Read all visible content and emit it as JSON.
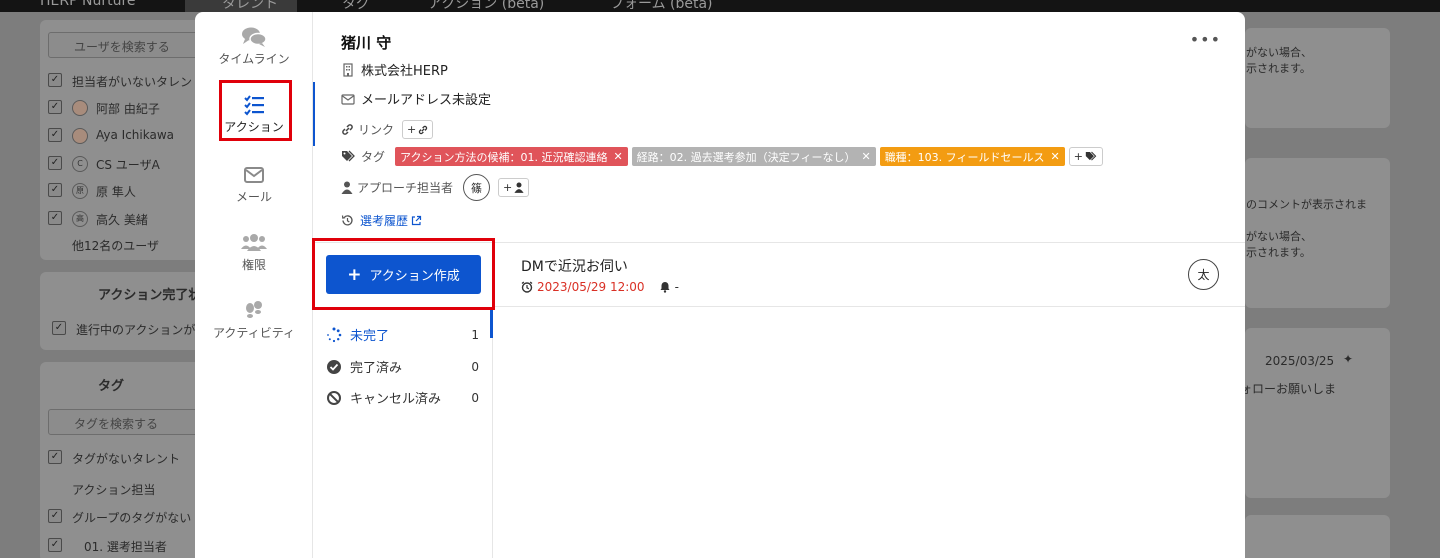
{
  "topbar": {
    "app_name": "HERP Nurture",
    "tabs": [
      "タレント",
      "タグ",
      "アクション (beta)",
      "フォーム (beta)"
    ]
  },
  "background": {
    "user_search_placeholder": "ユーザを検索する",
    "user_filter_items": [
      "担当者がいないタレン",
      "阿部 由紀子",
      "Aya Ichikawa",
      "CS ユーザA",
      "原 隼人",
      "高久 美緒"
    ],
    "user_filter_initials": [
      "",
      "",
      "",
      "C",
      "原",
      "高"
    ],
    "more_users": "他12名のユーザ",
    "action_status_header": "アクション完了状",
    "action_status_item": "進行中のアクションが",
    "tag_header": "タグ",
    "tag_search_placeholder": "タグを検索する",
    "tag_items": [
      "タグがないタレント"
    ],
    "tag_group": "アクション担当",
    "tag_items2": [
      "グループのタグがない",
      "01. 選考担当者"
    ],
    "right_texts": [
      "がない場合、",
      "示されます。",
      "のコメントが表示されま",
      "がない場合、",
      "示されます。",
      "ォローお願いしま"
    ],
    "right_date": "2025/03/25"
  },
  "modal": {
    "nav": [
      {
        "label": "タイムライン",
        "icon": "chat-bubbles-icon",
        "active": false
      },
      {
        "label": "アクション",
        "icon": "checklist-icon",
        "active": true
      },
      {
        "label": "メール",
        "icon": "envelope-icon",
        "active": false
      },
      {
        "label": "権限",
        "icon": "users-icon",
        "active": false
      },
      {
        "label": "アクティビティ",
        "icon": "footprints-icon",
        "active": false
      }
    ],
    "talent": {
      "name": "猪川 守",
      "company": "株式会社HERP",
      "email": "メールアドレス未設定",
      "link_label": "リンク",
      "tag_label": "タグ",
      "tags": [
        {
          "text": "アクション方法の候補：01. 近況確認連絡",
          "color": "#e0545a"
        },
        {
          "text": "経路：02. 過去選考参加（決定フィーなし）",
          "color": "#b3b3b3"
        },
        {
          "text": "職種：103. フィールドセールス",
          "color": "#f39c12"
        }
      ],
      "approach_label": "アプローチ担当者",
      "approach_user_initial": "篠",
      "history_link": "選考履歴",
      "more_label": "•••"
    },
    "actions": {
      "create_button": "アクション作成",
      "filters": [
        {
          "label": "未完了",
          "count": "1",
          "icon": "spinner-icon"
        },
        {
          "label": "完了済み",
          "count": "0",
          "icon": "check-circle-icon"
        },
        {
          "label": "キャンセル済み",
          "count": "0",
          "icon": "ban-icon"
        }
      ],
      "items": [
        {
          "title": "DMで近況お伺い",
          "date": "2023/05/29 12:00",
          "reminder": "-",
          "assignee_initial": "太"
        }
      ]
    }
  }
}
